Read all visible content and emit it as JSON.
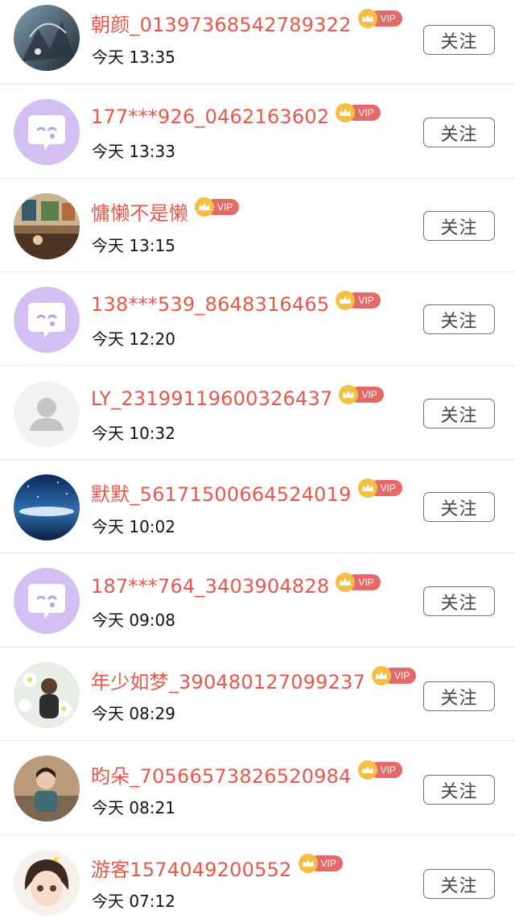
{
  "colors": {
    "name": "#e8574a",
    "vip_badge": "#e46a6a",
    "vip_crown": "#f4c043",
    "default_avatar_bg": "#d4bff3",
    "divider": "#e6e6e6"
  },
  "rows": [
    {
      "name": "朝颜_01397368542789322",
      "time": "今天 13:35",
      "vip": "VIP",
      "follow": "关注",
      "avatar": "fantasy-art-avatar"
    },
    {
      "name": "177***926_0462163602",
      "time": "今天 13:33",
      "vip": "VIP",
      "follow": "关注",
      "avatar": "chat-bubble-avatar"
    },
    {
      "name": "慵懒不是懒",
      "time": "今天 13:15",
      "vip": "VIP",
      "follow": "关注",
      "avatar": "room-photo-avatar"
    },
    {
      "name": "138***539_8648316465",
      "time": "今天 12:20",
      "vip": "VIP",
      "follow": "关注",
      "avatar": "chat-bubble-avatar"
    },
    {
      "name": "LY_23199119600326437",
      "time": "今天 10:32",
      "vip": "VIP",
      "follow": "关注",
      "avatar": "default-person-avatar"
    },
    {
      "name": "默默_56171500664524019",
      "time": "今天 10:02",
      "vip": "VIP",
      "follow": "关注",
      "avatar": "night-sky-avatar"
    },
    {
      "name": "187***764_3403904828",
      "time": "今天 09:08",
      "vip": "VIP",
      "follow": "关注",
      "avatar": "chat-bubble-avatar"
    },
    {
      "name": "年少如梦_390480127099237",
      "time": "今天 08:29",
      "vip": "VIP",
      "follow": "关注",
      "avatar": "flowers-person-avatar"
    },
    {
      "name": "昀朵_70566573826520984",
      "time": "今天 08:21",
      "vip": "VIP",
      "follow": "关注",
      "avatar": "girl-photo-avatar"
    },
    {
      "name": "游客1574049200552",
      "time": "今天 07:12",
      "vip": "VIP",
      "follow": "关注",
      "avatar": "anime-girl-avatar"
    }
  ]
}
